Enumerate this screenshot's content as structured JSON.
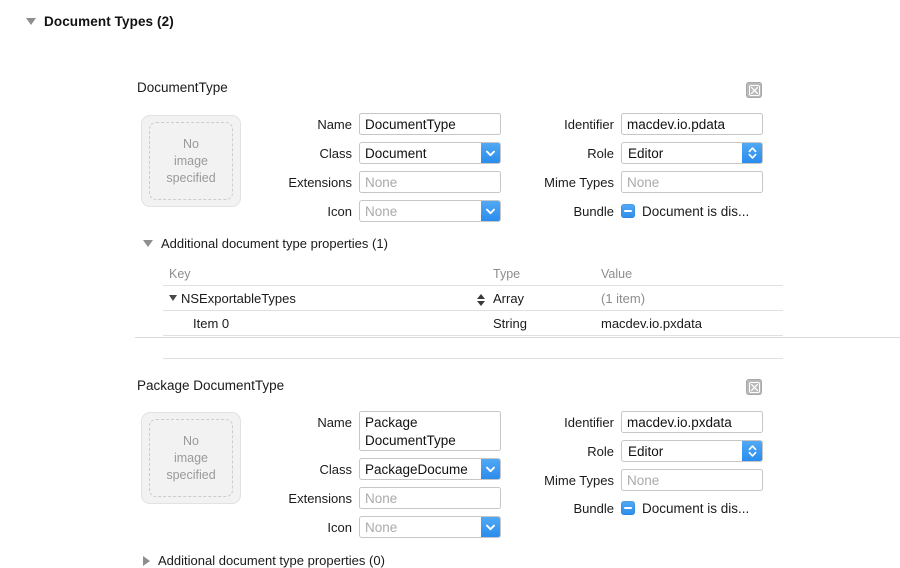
{
  "section": {
    "title": "Document Types (2)",
    "disclosure": "expanded",
    "disclosure_icon": "triangle-down-icon"
  },
  "labels": {
    "name": "Name",
    "class": "Class",
    "extensions": "Extensions",
    "icon": "Icon",
    "identifier": "Identifier",
    "role": "Role",
    "mime_types": "Mime Types",
    "bundle": "Bundle",
    "image_well_placeholder": "No\nimage\nspecified",
    "image_well_line1": "No",
    "image_well_line2": "image",
    "image_well_line3": "specified",
    "close_icon": "close-icon",
    "chevron_down_icon": "chevron-down-icon",
    "double_chevron_icon": "chevron-up-down-icon",
    "checkbox_mixed_icon": "checkbox-mixed-icon"
  },
  "table_headers": {
    "key": "Key",
    "type": "Type",
    "value": "Value"
  },
  "doctypes": [
    {
      "title": "DocumentType",
      "name_value": "DocumentType",
      "class_value": "Document",
      "extensions_value": "None",
      "extensions_is_placeholder": true,
      "icon_value": "None",
      "icon_is_placeholder": true,
      "identifier_value": "macdev.io.pdata",
      "role_value": "Editor",
      "mime_types_value": "None",
      "mime_types_is_placeholder": true,
      "bundle_label": "Document is dis...",
      "bundle_state": "mixed",
      "properties": {
        "title": "Additional document type properties (1)",
        "disclosure": "expanded",
        "disclosure_icon": "triangle-down-icon",
        "rows": [
          {
            "key": "NSExportableTypes",
            "type": "Array",
            "value": "(1 item)",
            "value_muted": true,
            "indent": 0,
            "expanded": true,
            "has_stepper": true
          },
          {
            "key": "Item 0",
            "type": "String",
            "value": "macdev.io.pxdata",
            "value_muted": false,
            "indent": 1,
            "expanded": false,
            "has_stepper": false
          }
        ]
      }
    },
    {
      "title": "Package DocumentType",
      "name_value": "Package DocumentType",
      "class_value": "PackageDocume",
      "extensions_value": "None",
      "extensions_is_placeholder": true,
      "icon_value": "None",
      "icon_is_placeholder": true,
      "identifier_value": "macdev.io.pxdata",
      "role_value": "Editor",
      "mime_types_value": "None",
      "mime_types_is_placeholder": true,
      "bundle_label": "Document is dis...",
      "bundle_state": "mixed",
      "properties": {
        "title": "Additional document type properties (0)",
        "disclosure": "collapsed",
        "disclosure_icon": "triangle-right-icon",
        "rows": []
      }
    }
  ],
  "colors": {
    "accent_blue": "#2a8ced",
    "field_border": "#c6c6c6",
    "placeholder_text": "#aaaaaa",
    "muted_text": "#8d8d8d",
    "divider": "#d9d9d9",
    "well_bg": "#f2f2f2"
  }
}
